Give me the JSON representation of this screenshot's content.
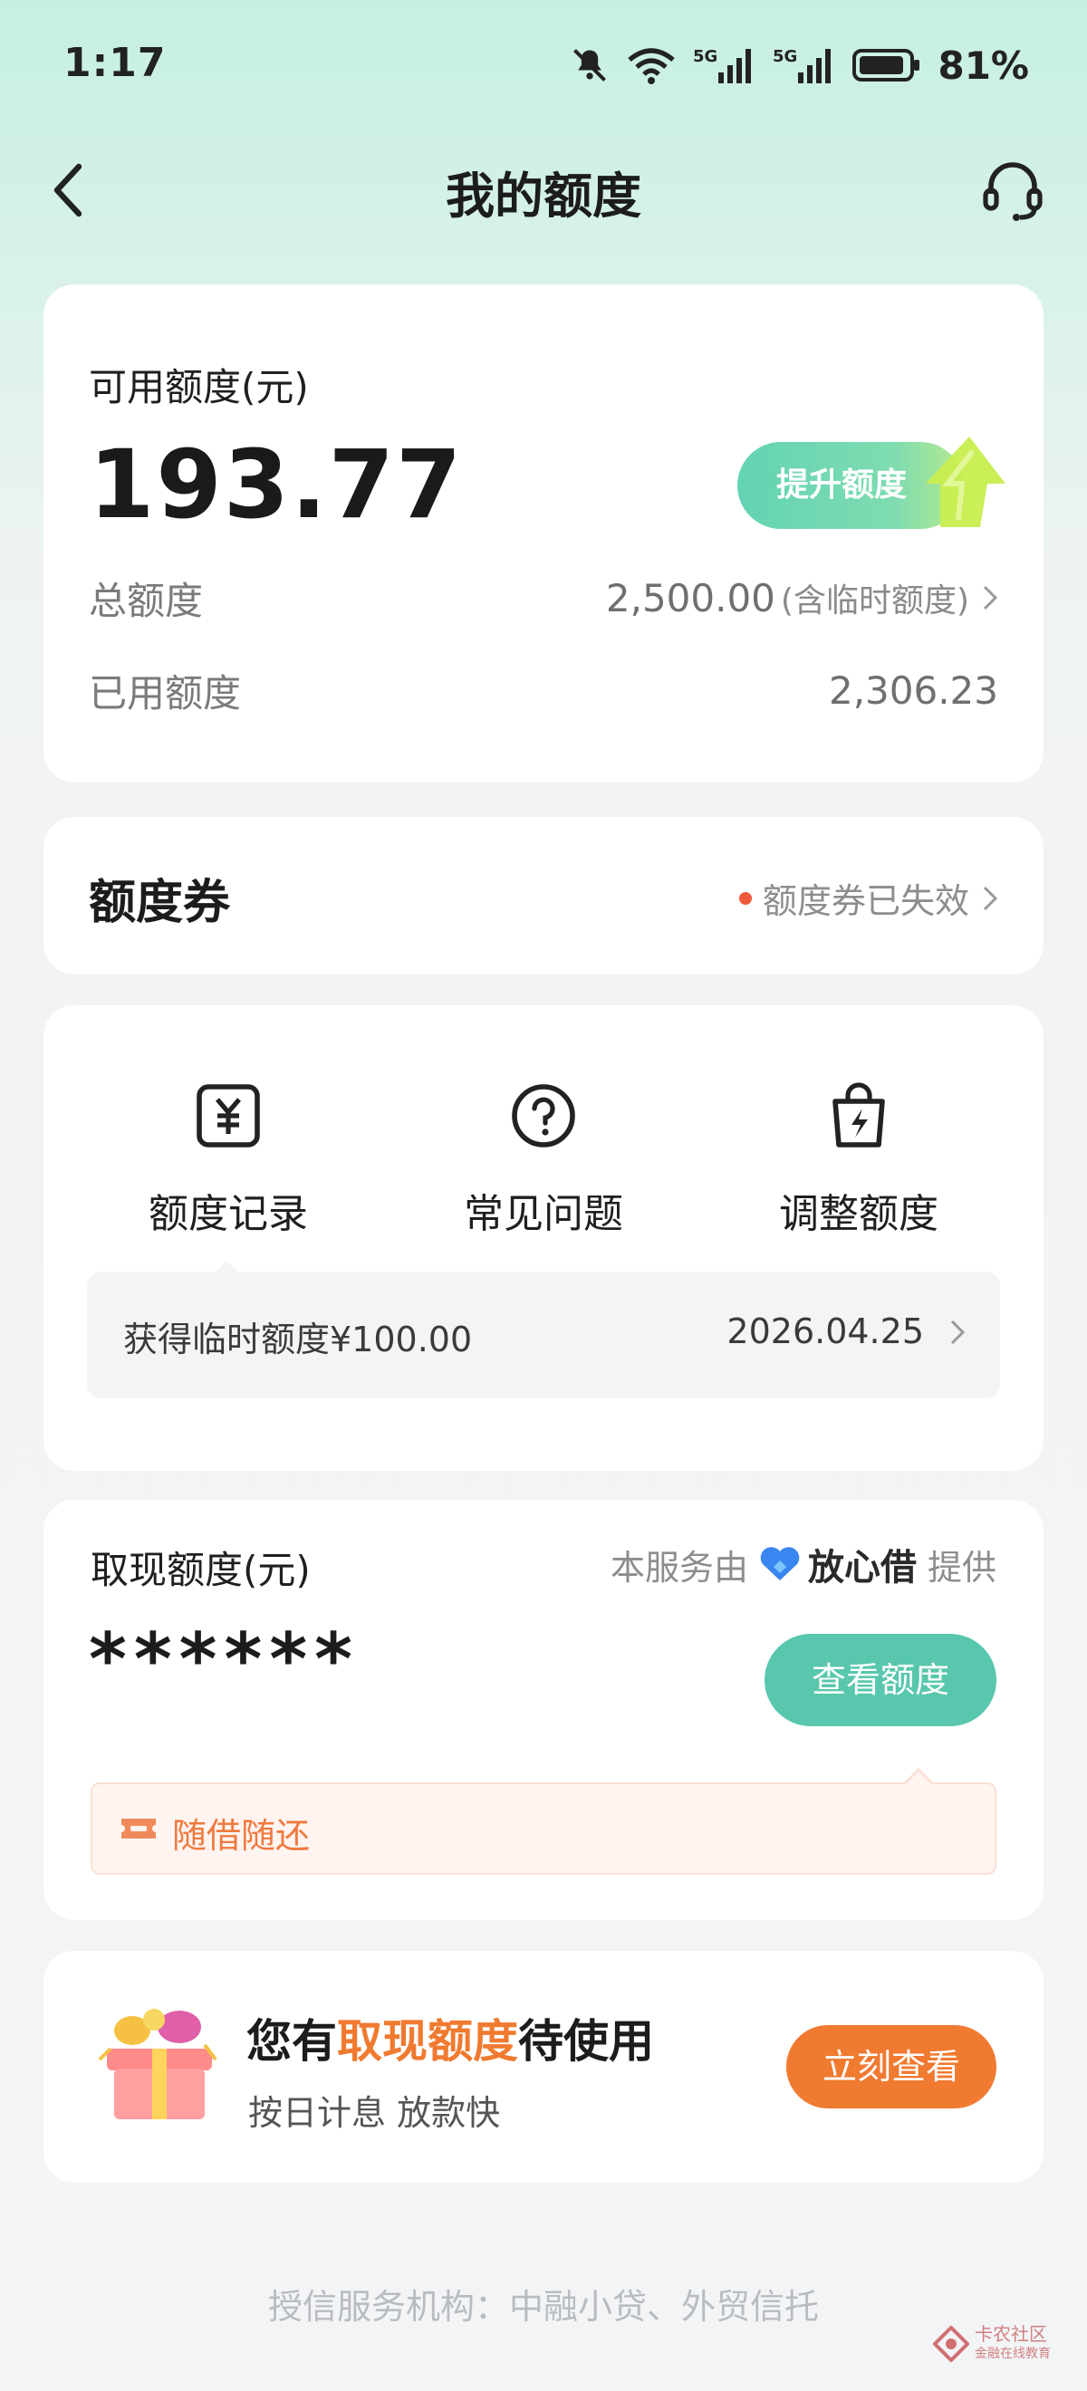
{
  "status_bar": {
    "time": "1:17",
    "battery": "81%"
  },
  "nav": {
    "title": "我的额度"
  },
  "credit_card": {
    "label": "可用额度(元)",
    "amount": "193.77",
    "raise_button": "提升额度",
    "total_label": "总额度",
    "total_value": "2,500.00",
    "total_note": "(含临时额度)",
    "used_label": "已用额度",
    "used_value": "2,306.23"
  },
  "coupon_card": {
    "title": "额度券",
    "status": "额度券已失效"
  },
  "quick_actions": {
    "items": [
      {
        "label": "额度记录",
        "icon": "yuan-receipt-icon"
      },
      {
        "label": "常见问题",
        "icon": "question-circle-icon"
      },
      {
        "label": "调整额度",
        "icon": "lightning-bag-icon"
      }
    ],
    "notice_text": "获得临时额度¥100.00",
    "notice_date": "2026.04.25"
  },
  "cash_card": {
    "label": "取现额度(元)",
    "provider_prefix": "本服务由",
    "provider_name": "放心借",
    "provider_suffix": "提供",
    "masked_amount": "******",
    "view_button": "查看额度",
    "banner_text": "随借随还"
  },
  "promo_card": {
    "title_before": "您有",
    "title_highlight": "取现额度",
    "title_after": "待使用",
    "subtitle": "按日计息 放款快",
    "button": "立刻查看"
  },
  "footer": {
    "text": "授信服务机构：中融小贷、外贸信托"
  },
  "watermark": {
    "name": "卡农社区",
    "sub": "金融在线教育"
  },
  "colors": {
    "accent_green": "#58c7ad",
    "accent_orange": "#f07a30",
    "alert_red": "#ef5a3c"
  }
}
